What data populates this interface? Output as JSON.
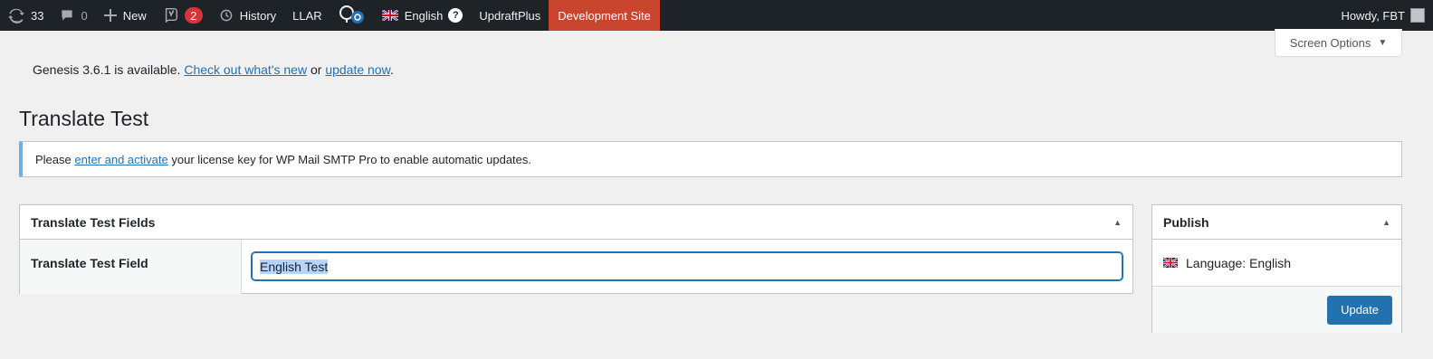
{
  "adminbar": {
    "updates_count": "33",
    "comments_count": "0",
    "new_label": "New",
    "yoast_badge": "2",
    "history_label": "History",
    "llar_label": "LLAR",
    "language_label": "English",
    "help_glyph": "?",
    "updraft_label": "UpdraftPlus",
    "devsite_label": "Development Site",
    "howdy_label": "Howdy, FBT",
    "colors": {
      "bar": "#1d2327",
      "devsite": "#c9452e",
      "badge": "#d63638"
    }
  },
  "screen_options": {
    "label": "Screen Options"
  },
  "update_notice": {
    "text_before": "Genesis 3.6.1 is available.",
    "link1": "Check out what's new",
    "text_middle": "or",
    "link2": "update now",
    "text_after": "."
  },
  "page": {
    "title": "Translate Test"
  },
  "license_notice": {
    "text_before": "Please",
    "link": "enter and activate",
    "text_after": "your license key for WP Mail SMTP Pro to enable automatic updates."
  },
  "fields_box": {
    "title": "Translate Test Fields",
    "field_label": "Translate Test Field",
    "field_value": "English Test"
  },
  "publish_box": {
    "title": "Publish",
    "language": "Language: English",
    "update_label": "Update"
  }
}
